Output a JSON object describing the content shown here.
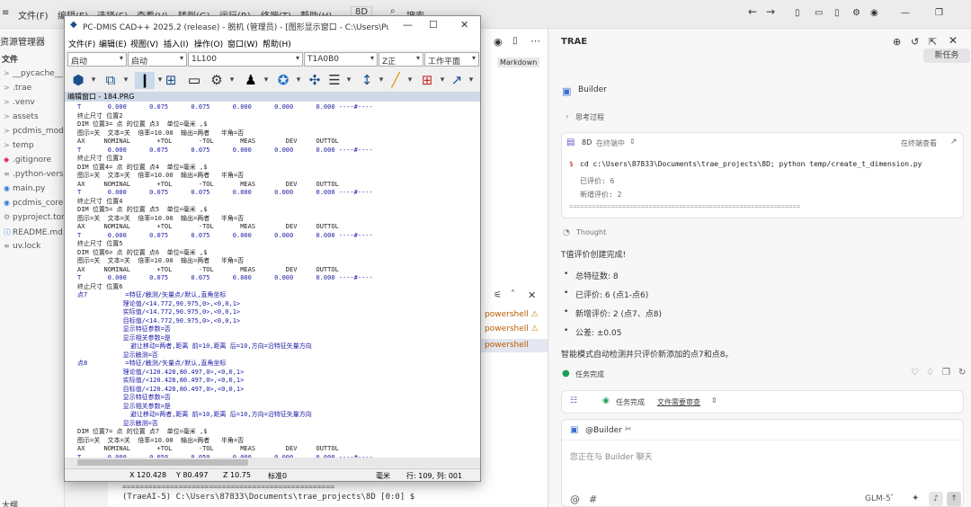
{
  "ide": {
    "menu": [
      "文件(F)",
      "编辑(E)",
      "选择(S)",
      "查看(V)",
      "转到(G)",
      "运行(R)",
      "终端(T)",
      "帮助(H)",
      "8D"
    ],
    "search": "搜索",
    "explorer_title": "资源管理器",
    "files_header": "文件",
    "tree": [
      {
        "name": "__pycache__",
        "icon": ">"
      },
      {
        "name": ".trae",
        "icon": ">"
      },
      {
        "name": ".venv",
        "icon": ">"
      },
      {
        "name": "assets",
        "icon": ">"
      },
      {
        "name": "pcdmis_mod",
        "icon": ">"
      },
      {
        "name": "temp",
        "icon": ">"
      },
      {
        "name": ".gitignore",
        "icon": "◆"
      },
      {
        "name": ".python-vers",
        "icon": "≡"
      },
      {
        "name": "main.py",
        "icon": "◉"
      },
      {
        "name": "pcdmis_core",
        "icon": "◉"
      },
      {
        "name": "pyproject.tor",
        "icon": "⚙"
      },
      {
        "name": "README.md",
        "icon": "ⓘ"
      },
      {
        "name": "uv.lock",
        "icon": "≡"
      }
    ],
    "outline": "大纲",
    "markdown_tab": "Markdown",
    "terminals": [
      "powershell",
      "powershell",
      "powershell"
    ],
    "terminal_lines": [
      "=================================================",
      "(TraeAI-5) C:\\Users\\87833\\Documents\\trae_projects\\8D [0:0] $"
    ]
  },
  "trae": {
    "title": "TRAE",
    "new_task": "新任务",
    "agent": "Builder",
    "thinking": "思考过程",
    "project": "8D",
    "running": "在终端中",
    "view_terminal": "在终端查看",
    "command": "cd c:\\Users\\87833\\Documents\\trae_projects\\8D; python temp/create_t_dimension.py",
    "out1": "已评价: 6",
    "out2": "新增评价: 2",
    "out3": "=============================================================",
    "thought": "Thought",
    "done_msg": "T值评价创建完成!",
    "bullets": [
      "总特征数: 8",
      "已评价: 6 (点1-点6)",
      "新增评价: 2 (点7、点8)",
      "公差: ±0.05"
    ],
    "summary": "智能模式自动检测并只评价新添加的点7和点8。",
    "task_done": "任务完成",
    "task_done2": "任务完成",
    "review": "文件需要审查",
    "mention": "@Builder",
    "placeholder": "您正在与 Builder 聊天",
    "model": "GLM-5"
  },
  "cad": {
    "title": "PC-DMIS CAD++ 2025.2 (release) - 脱机 (管理员) - [图形显示窗口 - C:\\Users\\Public\\...",
    "menu": [
      "文件(F)",
      "编辑(E)",
      "视图(V)",
      "插入(I)",
      "操作(O)",
      "窗口(W)",
      "帮助(H)"
    ],
    "boxes": [
      "启动",
      "启动",
      "1L100",
      "T1A0B0",
      "Z正",
      "工作平面"
    ],
    "editor_header": "编辑窗口 - 184.PRG",
    "status": {
      "x": "X 120.428",
      "y": "Y 80.497",
      "z": "Z 10.75",
      "std": "标准0",
      "unit": "毫米",
      "pos": "行: 109, 列: 001"
    },
    "lines": [
      {
        "t": "T       0.000      0.075      0.075      0.000      0.000      0.000 ----#----",
        "c": "b"
      },
      {
        "t": "终止尺寸 位置2",
        "c": ""
      },
      {
        "t": "DIM 位置3= 点 的位置 点3  单位=毫米 ,$",
        "c": ""
      },
      {
        "t": "图示=关  文本=关  倍率=10.00  输出=两者   半角=否",
        "c": ""
      },
      {
        "t": "AX     NOMINAL       +TOL       -TOL       MEAS        DEV     OUTTOL",
        "c": ""
      },
      {
        "t": "T       0.000      0.075      0.075      0.000      0.000      0.000 ----#----",
        "c": "b"
      },
      {
        "t": "终止尺寸 位置3",
        "c": ""
      },
      {
        "t": "DIM 位置4= 点 的位置 点4  单位=毫米 ,$",
        "c": ""
      },
      {
        "t": "图示=关  文本=关  倍率=10.00  输出=两者   半角=否",
        "c": ""
      },
      {
        "t": "AX     NOMINAL       +TOL       -TOL       MEAS        DEV     OUTTOL",
        "c": ""
      },
      {
        "t": "T       0.000      0.075      0.075      0.000      0.000      0.000 ----#----",
        "c": "b"
      },
      {
        "t": "终止尺寸 位置4",
        "c": ""
      },
      {
        "t": "DIM 位置5= 点 的位置 点5  单位=毫米 ,$",
        "c": ""
      },
      {
        "t": "图示=关  文本=关  倍率=10.00  输出=两者   半角=否",
        "c": ""
      },
      {
        "t": "AX     NOMINAL       +TOL       -TOL       MEAS        DEV     OUTTOL",
        "c": ""
      },
      {
        "t": "T       0.000      0.075      0.075      0.000      0.000      0.000 ----#----",
        "c": "b"
      },
      {
        "t": "终止尺寸 位置5",
        "c": ""
      },
      {
        "t": "DIM 位置6= 点 的位置 点6  单位=毫米 ,$",
        "c": ""
      },
      {
        "t": "图示=关  文本=关  倍率=10.00  输出=两者   半角=否",
        "c": ""
      },
      {
        "t": "AX     NOMINAL       +TOL       -TOL       MEAS        DEV     OUTTOL",
        "c": ""
      },
      {
        "t": "T       0.000      0.075      0.075      0.000      0.000      0.000 ----#----",
        "c": "b"
      },
      {
        "t": "终止尺寸 位置6",
        "c": ""
      },
      {
        "t": "点7          =特征/触测/矢量点/默认,直角坐标",
        "c": "b"
      },
      {
        "t": "            理论值/<14.772,90.975,0>,<0,0,1>",
        "c": "b"
      },
      {
        "t": "            实际值/<14.772,90.975,0>,<0,0,1>",
        "c": "b"
      },
      {
        "t": "            目标值/<14.772,90.975,0>,<0,0,1>",
        "c": "b"
      },
      {
        "t": "            显示特征参数=否",
        "c": "b"
      },
      {
        "t": "            显示相关参数=是",
        "c": "b"
      },
      {
        "t": "              避让移动=两者,距离 前=10,距离 后=10,方向=沿特征矢量方向",
        "c": "b"
      },
      {
        "t": "            显示触测=否",
        "c": "b"
      },
      {
        "t": "点8          =特征/触测/矢量点/默认,直角坐标",
        "c": "b"
      },
      {
        "t": "            理论值/<120.428,80.497,0>,<0,0,1>",
        "c": "b"
      },
      {
        "t": "            实际值/<120.428,80.497,0>,<0,0,1>",
        "c": "b"
      },
      {
        "t": "            目标值/<120.428,80.497,0>,<0,0,1>",
        "c": "b"
      },
      {
        "t": "            显示特征参数=否",
        "c": "b"
      },
      {
        "t": "            显示相关参数=是",
        "c": "b"
      },
      {
        "t": "              避让移动=两者,距离 前=10,距离 后=10,方向=沿特征矢量方向",
        "c": "b"
      },
      {
        "t": "            显示触测=否",
        "c": "b"
      },
      {
        "t": "DIM 位置7= 点 的位置 点7  单位=毫米 ,$",
        "c": ""
      },
      {
        "t": "图示=关  文本=关  倍率=10.00  输出=两者   半角=否",
        "c": ""
      },
      {
        "t": "AX     NOMINAL       +TOL       -TOL       MEAS        DEV     OUTTOL",
        "c": ""
      },
      {
        "t": "T       0.000      0.050      0.050      0.000      0.000      0.000 ----#----",
        "c": "b"
      }
    ]
  }
}
